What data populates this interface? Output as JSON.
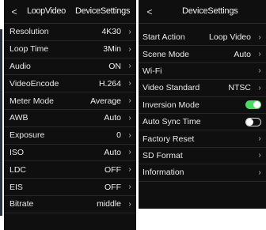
{
  "left": {
    "back_symbol": "<",
    "header_1": "LoopVideo",
    "header_2": "DeviceSettings",
    "rows": [
      {
        "label": "Resolution",
        "value": "4K30",
        "chevron": "›"
      },
      {
        "label": "Loop Time",
        "value": "3Min",
        "chevron": "›"
      },
      {
        "label": "Audio",
        "value": "ON",
        "chevron": "›"
      },
      {
        "label": "VideoEncode",
        "value": "H.264",
        "chevron": "›"
      },
      {
        "label": "Meter Mode",
        "value": "Average",
        "chevron": "›"
      },
      {
        "label": "AWB",
        "value": "Auto",
        "chevron": "›"
      },
      {
        "label": "Exposure",
        "value": "0",
        "chevron": "›"
      },
      {
        "label": "ISO",
        "value": "Auto",
        "chevron": "›"
      },
      {
        "label": "LDC",
        "value": "OFF",
        "chevron": "›"
      },
      {
        "label": "EIS",
        "value": "OFF",
        "chevron": "›"
      },
      {
        "label": "Bitrate",
        "value": "middle",
        "chevron": "›"
      }
    ]
  },
  "right": {
    "back_symbol": "<",
    "title": "DeviceSettings",
    "rows": [
      {
        "label": "Start Action",
        "value": "Loop Video",
        "chevron": "›"
      },
      {
        "label": "Scene Mode",
        "value": "Auto",
        "chevron": "›"
      },
      {
        "label": "Wi-Fi",
        "value": "",
        "chevron": "›"
      },
      {
        "label": "Video Standard",
        "value": "NTSC",
        "chevron": "›"
      },
      {
        "label": "Inversion Mode",
        "toggle": "on"
      },
      {
        "label": "Auto Sync Time",
        "toggle": "off"
      },
      {
        "label": "Factory Reset",
        "value": "",
        "chevron": "›"
      },
      {
        "label": "SD Format",
        "value": "",
        "chevron": "›"
      },
      {
        "label": "Information",
        "value": "",
        "chevron": "›"
      }
    ]
  },
  "colors": {
    "panel": "#0f0f0f",
    "toggle_on": "#4cd964",
    "text": "#ececec"
  }
}
